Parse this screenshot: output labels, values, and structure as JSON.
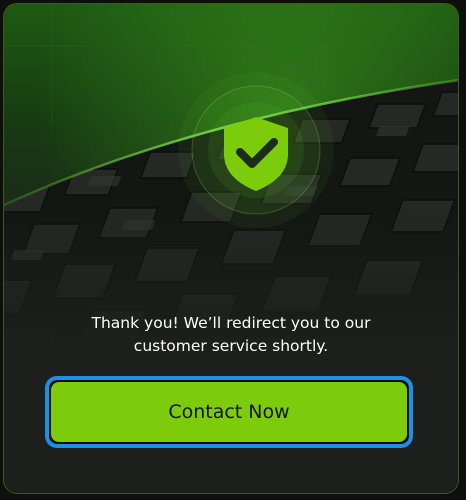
{
  "dialog": {
    "message_line_1": "Thank you! We’ll redirect you to our",
    "message_line_2": "customer service shortly.",
    "cta_label": "Contact Now"
  },
  "icons": {
    "status": "shield-check-icon"
  },
  "colors": {
    "accent": "#7ccc0b",
    "focus_ring": "#1f8fe6",
    "background": "#1d1f1d",
    "text": "#ffffff"
  }
}
